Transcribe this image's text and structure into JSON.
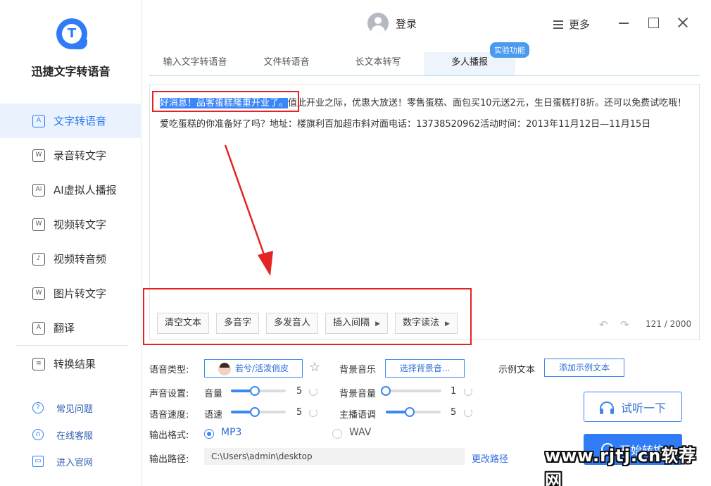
{
  "app": {
    "title": "迅捷文字转语音"
  },
  "sidebar": {
    "items": [
      {
        "label": "文字转语音",
        "icon": "text-to-speech-icon",
        "active": true
      },
      {
        "label": "录音转文字",
        "icon": "recording-icon"
      },
      {
        "label": "AI虚拟人播报",
        "icon": "avatar-broadcast-icon"
      },
      {
        "label": "视频转文字",
        "icon": "video-text-icon"
      },
      {
        "label": "视频转音频",
        "icon": "video-audio-icon"
      },
      {
        "label": "图片转文字",
        "icon": "image-text-icon"
      },
      {
        "label": "翻译",
        "icon": "translate-icon"
      }
    ],
    "result": {
      "label": "转换结果",
      "icon": "result-icon"
    },
    "help": [
      {
        "label": "常见问题",
        "icon": "question-icon"
      },
      {
        "label": "在线客服",
        "icon": "headset-icon"
      },
      {
        "label": "进入官网",
        "icon": "website-icon"
      }
    ]
  },
  "header": {
    "login_label": "登录",
    "more_label": "更多"
  },
  "tabs": [
    {
      "label": "输入文字转语音"
    },
    {
      "label": "文件转语音"
    },
    {
      "label": "长文本转写"
    },
    {
      "label": "多人播报",
      "active": true
    }
  ],
  "tab_badge": "实验功能",
  "editor": {
    "highlighted": "好消息！品客蛋糕隆重开业了。",
    "text": "值此开业之际，优惠大放送！零售蛋糕、面包买10元送2元，生日蛋糕打8折。还可以免费试吃哦！爱吃蛋糕的你准备好了吗？地址：楼旗利百加超市斜对面电话：13738520962活动时间：2013年11月12日—11月15日",
    "count": "121 / 2000",
    "tools": [
      {
        "label": "清空文本"
      },
      {
        "label": "多音字"
      },
      {
        "label": "多发音人"
      },
      {
        "label": "插入间隔",
        "arrow": "▶"
      },
      {
        "label": "数字读法",
        "arrow": "▶"
      }
    ]
  },
  "settings": {
    "voice_type_label": "语音类型:",
    "voice_name": "若兮/活泼俏皮",
    "bgm_label": "背景音乐",
    "bgm_button": "选择背景音...",
    "sample_label": "示例文本",
    "sample_button": "添加示例文本",
    "sound_label": "声音设置:",
    "volume_label": "音量",
    "volume_value": "5",
    "bg_volume_label": "背景音量",
    "bg_volume_value": "1",
    "speed_label": "语音速度:",
    "rate_label": "语速",
    "rate_value": "5",
    "tone_label": "主播语调",
    "tone_value": "5",
    "format_label": "输出格式:",
    "format_options": [
      "MP3",
      "WAV"
    ],
    "format_selected": "MP3",
    "path_label": "输出路径:",
    "path_value": "C:\\Users\\admin\\desktop",
    "change_path": "更改路径"
  },
  "actions": {
    "listen": "试听一下",
    "start": "开始转换"
  },
  "watermark": "www.rjtj.cn软荐网",
  "colors": {
    "accent": "#2f7cf6",
    "annotation": "#e42323"
  }
}
